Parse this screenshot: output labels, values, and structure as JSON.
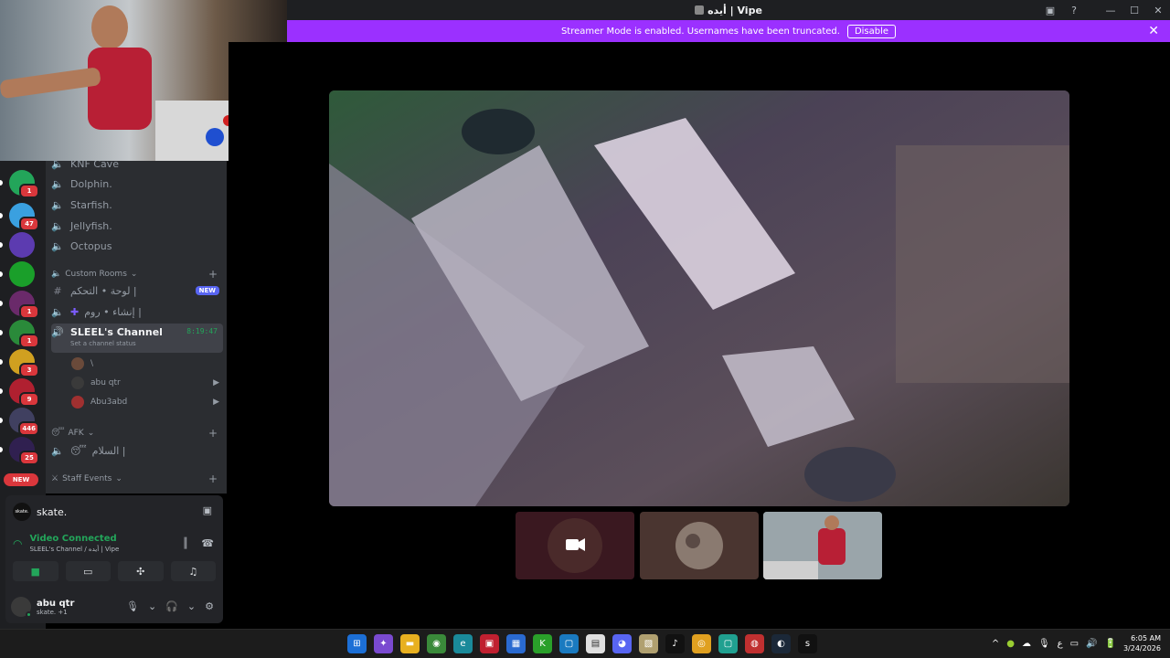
{
  "window": {
    "title": "أيده | Vipe",
    "controls": [
      "▣",
      "?",
      "—",
      "☐",
      "✕"
    ]
  },
  "banner": {
    "message": "Streamer Mode is enabled. Usernames have been truncated.",
    "disable_label": "Disable",
    "close": "✕"
  },
  "rail": {
    "servers": [
      {
        "name": "discord-home",
        "color": "#23a55a",
        "badge": "1"
      },
      {
        "name": "server-2",
        "color": "#3aa0e0",
        "badge": "47"
      },
      {
        "name": "server-3",
        "color": "#5c3bb0",
        "badge": ""
      },
      {
        "name": "server-4",
        "color": "#1a9f2a",
        "badge": ""
      },
      {
        "name": "server-5",
        "color": "#6a2a6a",
        "badge": "1"
      },
      {
        "name": "server-6",
        "color": "#2a8a3a",
        "badge": "1"
      },
      {
        "name": "server-7",
        "color": "#d0a020",
        "badge": "3"
      },
      {
        "name": "server-8",
        "color": "#b02030",
        "badge": "9"
      },
      {
        "name": "server-9",
        "color": "#404060",
        "badge": "446"
      },
      {
        "name": "server-10",
        "color": "#302050",
        "badge": "25"
      }
    ],
    "new_label": "NEW"
  },
  "channels": {
    "top": [
      {
        "icon": "speaker",
        "label": "KNF Cave"
      },
      {
        "icon": "speaker",
        "label": "Dolphin."
      },
      {
        "icon": "speaker",
        "label": "Starfish."
      },
      {
        "icon": "speaker",
        "label": "Jellyfish."
      },
      {
        "icon": "speaker",
        "label": "Octopus"
      }
    ],
    "custom_rooms_label": "Custom Rooms",
    "panel_channel": {
      "icon": "#",
      "label": "لوحة • التحكم |",
      "tag": "NEW"
    },
    "create_channel": {
      "label": "إنشاء • روم |"
    },
    "active": {
      "label": "SLEEL's Channel",
      "status": "Set a channel status",
      "timer": "8:19:47"
    },
    "members": [
      {
        "name": "\\",
        "camera": false,
        "color": "#6a4a3a"
      },
      {
        "name": "abu qtr",
        "camera": true,
        "color": "#3a3a3a"
      },
      {
        "name": "Abu3abd",
        "camera": true,
        "color": "#a03030"
      }
    ],
    "afk_label": "AFK",
    "afk_channel": {
      "label": "السلام |"
    },
    "staff_events_label": "Staff Events"
  },
  "rtc": {
    "activity_name": "skate.",
    "logo_text": "skate.",
    "status": "Video Connected",
    "location": "SLEEL's Channel / أيده | Vipe",
    "actions": [
      "camera",
      "share-screen",
      "activities",
      "soundboard"
    ]
  },
  "user": {
    "name": "abu qtr",
    "status": "skate. +1"
  },
  "stage": {
    "tiles": [
      {
        "name": "tile-camera-off",
        "color": "#3a1820"
      },
      {
        "name": "tile-avatar",
        "color": "#4a3530"
      },
      {
        "name": "tile-webcam",
        "color": "#8a9aa0"
      }
    ]
  },
  "taskbar": {
    "apps": [
      {
        "name": "start",
        "color": "#1c6fd6",
        "glyph": "⊞"
      },
      {
        "name": "copilot",
        "color": "#7a4ad0",
        "glyph": "✦"
      },
      {
        "name": "explorer",
        "color": "#e8b020",
        "glyph": "▬"
      },
      {
        "name": "chrome",
        "color": "#3a8a3a",
        "glyph": "◉"
      },
      {
        "name": "edge",
        "color": "#1a8a9a",
        "glyph": "e"
      },
      {
        "name": "app-5",
        "color": "#c02030",
        "glyph": "▣"
      },
      {
        "name": "store",
        "color": "#2a6ad0",
        "glyph": "▦"
      },
      {
        "name": "kick",
        "color": "#2aa02a",
        "glyph": "K"
      },
      {
        "name": "app-8",
        "color": "#1a7ac0",
        "glyph": "▢"
      },
      {
        "name": "notepad",
        "color": "#e0e0e0",
        "glyph": "▤"
      },
      {
        "name": "discord",
        "color": "#5865f2",
        "glyph": "◕"
      },
      {
        "name": "app-11",
        "color": "#b0a070",
        "glyph": "▧"
      },
      {
        "name": "tiktok",
        "color": "#111",
        "glyph": "♪"
      },
      {
        "name": "app-13",
        "color": "#e0a020",
        "glyph": "◎"
      },
      {
        "name": "app-14",
        "color": "#20a090",
        "glyph": "▢"
      },
      {
        "name": "app-15",
        "color": "#c03030",
        "glyph": "◍"
      },
      {
        "name": "steam",
        "color": "#1b2838",
        "glyph": "◐"
      },
      {
        "name": "skate",
        "color": "#111",
        "glyph": "s"
      }
    ],
    "tray": [
      "^",
      "●",
      "☁",
      "🎙",
      "ع",
      "▭",
      "🔊",
      "🔋"
    ],
    "time": "6:05 AM",
    "date": "3/24/2026"
  }
}
